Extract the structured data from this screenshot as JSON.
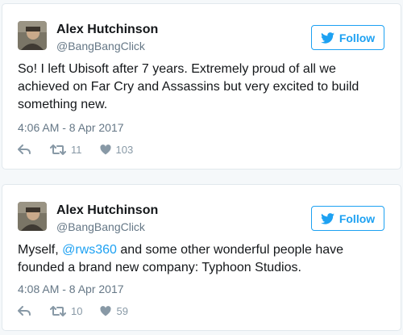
{
  "tweets": [
    {
      "name": "Alex Hutchinson",
      "handle": "@BangBangClick",
      "follow_label": "Follow",
      "text_before": "So! I left Ubisoft after 7 years. Extremely proud of all we achieved on Far Cry and Assassins but very excited to build something new.",
      "mention": "",
      "text_after": "",
      "timestamp": "4:06 AM - 8 Apr 2017",
      "retweets": "11",
      "likes": "103"
    },
    {
      "name": "Alex Hutchinson",
      "handle": "@BangBangClick",
      "follow_label": "Follow",
      "text_before": "Myself, ",
      "mention": "@rws360",
      "text_after": " and some other wonderful people have founded a brand new company: Typhoon Studios.",
      "timestamp": "4:08 AM - 8 Apr 2017",
      "retweets": "10",
      "likes": "59"
    }
  ],
  "icons": {
    "follow": "twitter-bird-icon",
    "reply": "reply-icon",
    "retweet": "retweet-icon",
    "like": "heart-icon"
  },
  "colors": {
    "accent": "#1da1f2",
    "secondary_text": "#657786",
    "action_icons": "#8899a6",
    "border": "#e1e8ed"
  }
}
